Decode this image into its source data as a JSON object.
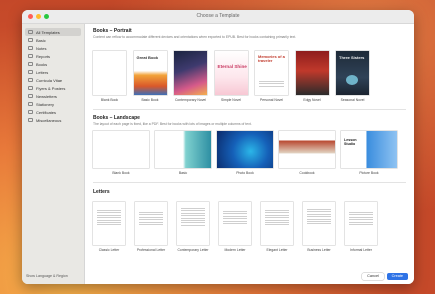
{
  "window": {
    "title": "Choose a Template"
  },
  "sidebar": {
    "items": [
      {
        "label": "All Templates",
        "icon": "grid-icon"
      },
      {
        "label": "Basic",
        "icon": "document-icon"
      },
      {
        "label": "Notes",
        "icon": "document-icon"
      },
      {
        "label": "Reports",
        "icon": "document-icon"
      },
      {
        "label": "Books",
        "icon": "book-icon"
      },
      {
        "label": "Letters",
        "icon": "document-icon"
      },
      {
        "label": "Curricula Vitae",
        "icon": "document-icon"
      },
      {
        "label": "Flyers & Posters",
        "icon": "document-icon"
      },
      {
        "label": "Newsletters",
        "icon": "document-icon"
      },
      {
        "label": "Stationery",
        "icon": "document-icon"
      },
      {
        "label": "Certificates",
        "icon": "document-icon"
      },
      {
        "label": "Miscellaneous",
        "icon": "document-icon"
      }
    ],
    "footer": "Show Language & Region"
  },
  "sections": {
    "portrait": {
      "title": "Books – Portrait",
      "desc": "Content can reflow to accommodate different devices and orientations when exported to EPUB. Best for books containing primarily text.",
      "templates": [
        {
          "label": "Blank Book"
        },
        {
          "label": "Basic Book",
          "cover_title": "Great Book"
        },
        {
          "label": "Contemporary Novel"
        },
        {
          "label": "Simple Novel",
          "cover_title": "Eternal Shine"
        },
        {
          "label": "Personal Novel",
          "cover_title": "Memories of a traveler"
        },
        {
          "label": "Edgy Novel"
        },
        {
          "label": "Seasonal Novel",
          "cover_title": "Three Sisters"
        }
      ]
    },
    "landscape": {
      "title": "Books – Landscape",
      "desc": "The layout of each page is fixed, like a PDF. Best for books with lots of images or multiple columns of text.",
      "templates": [
        {
          "label": "Blank Book"
        },
        {
          "label": "Basic"
        },
        {
          "label": "Photo Book"
        },
        {
          "label": "Cookbook"
        },
        {
          "label": "Picture Book",
          "cover_title": "Lesson Studio"
        }
      ]
    },
    "letters": {
      "title": "Letters",
      "templates": [
        {
          "label": "Classic Letter"
        },
        {
          "label": "Professional Letter"
        },
        {
          "label": "Contemporary Letter"
        },
        {
          "label": "Modern Letter"
        },
        {
          "label": "Elegant Letter"
        },
        {
          "label": "Business Letter"
        },
        {
          "label": "Informal Letter"
        }
      ]
    }
  },
  "buttons": {
    "cancel": "Cancel",
    "create": "Create"
  },
  "colors": {
    "accent": "#2f73e6"
  }
}
